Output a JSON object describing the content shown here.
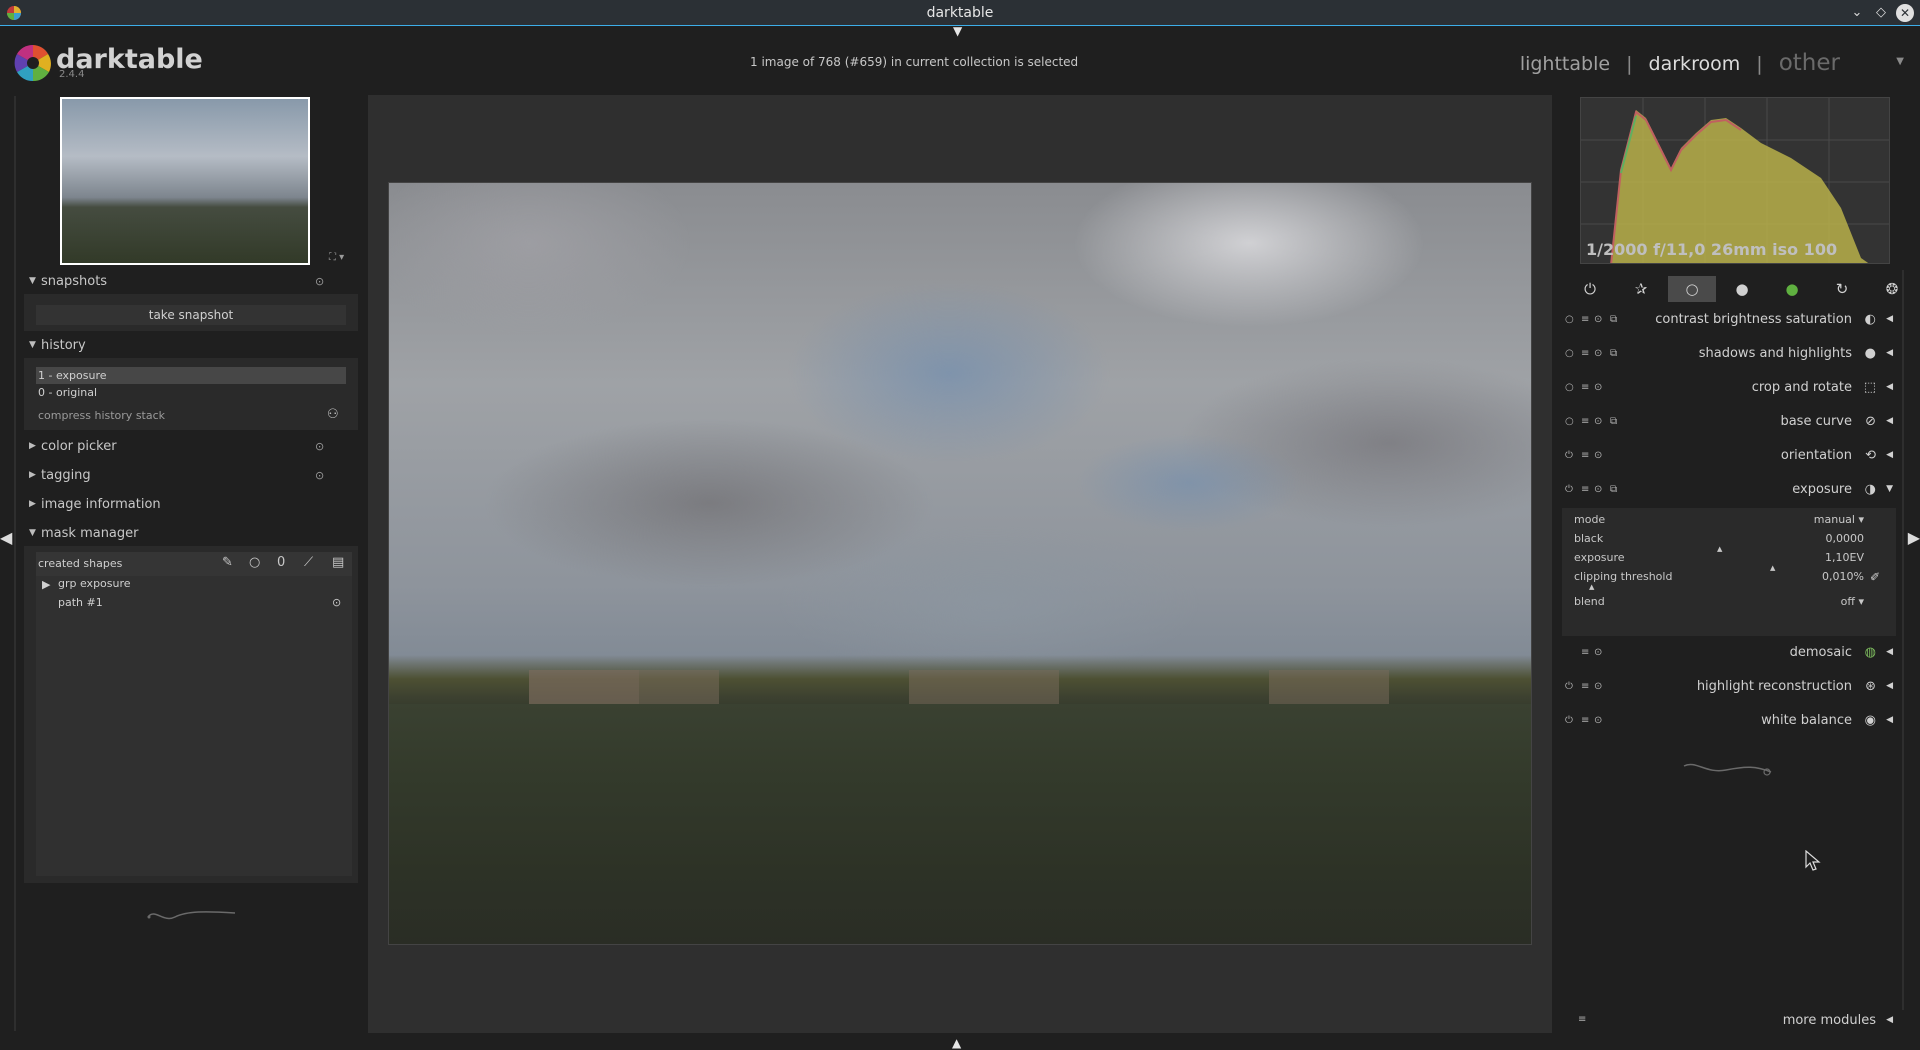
{
  "window": {
    "title": "darktable",
    "minimize": "⌄",
    "maximize": "◇",
    "close": "✕"
  },
  "header": {
    "logo": "darktable",
    "version": "2.4.4",
    "selection_info": "1 image of 768 (#659) in current collection is selected",
    "views": [
      {
        "label": "lighttable",
        "active": false
      },
      {
        "label": "darkroom",
        "active": true
      },
      {
        "label": "other",
        "active": false
      }
    ],
    "view_separator": "|",
    "view_menu_arrow": "▼"
  },
  "left_panel": {
    "thumb_icons": "⛶ ▾",
    "snapshots": {
      "label": "snapshots",
      "take_snapshot": "take snapshot"
    },
    "history": {
      "label": "history",
      "items": [
        {
          "label": "1 - exposure",
          "selected": true
        },
        {
          "label": "0 - original",
          "selected": false
        }
      ],
      "compress": "compress history stack"
    },
    "color_picker": {
      "label": "color picker"
    },
    "tagging": {
      "label": "tagging"
    },
    "image_information": {
      "label": "image information"
    },
    "mask_manager": {
      "label": "mask manager",
      "created_shapes": "created shapes",
      "items": [
        {
          "label": "grp exposure"
        },
        {
          "label": "path #1"
        }
      ]
    }
  },
  "right_panel": {
    "histogram_info": "1/2000 f/11,0 26mm iso 100",
    "modules": [
      {
        "name": "contrast brightness saturation"
      },
      {
        "name": "shadows and highlights"
      },
      {
        "name": "crop and rotate"
      },
      {
        "name": "base curve"
      },
      {
        "name": "orientation"
      },
      {
        "name": "exposure"
      }
    ],
    "exposure_params": [
      {
        "key": "mode",
        "value": "manual ▾"
      },
      {
        "key": "black",
        "value": "0,0000"
      },
      {
        "key": "exposure",
        "value": "1,10EV"
      },
      {
        "key": "clipping threshold",
        "value": "0,010%"
      },
      {
        "key": "blend",
        "value": "off ▾"
      }
    ],
    "modules_after": [
      {
        "name": "demosaic"
      },
      {
        "name": "highlight reconstruction"
      },
      {
        "name": "white balance"
      }
    ],
    "more_modules": "more modules"
  },
  "colors": {
    "accent": "#3daee9",
    "panel": "#2a2a2a",
    "bg": "#1f1f1f"
  }
}
